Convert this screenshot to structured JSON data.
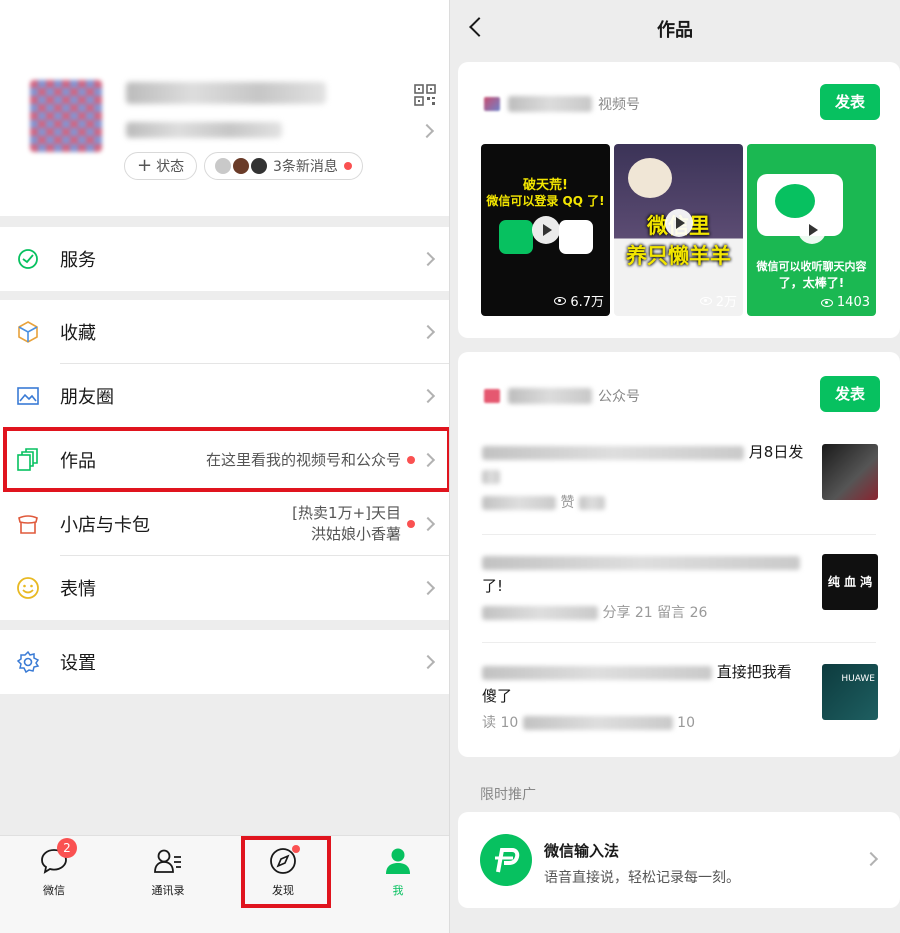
{
  "left": {
    "profile": {
      "status_label": "状态",
      "messages_label": "3条新消息"
    },
    "menu": {
      "service": "服务",
      "favorites": "收藏",
      "moments": "朋友圈",
      "works": "作品",
      "works_hint": "在这里看我的视频号和公众号",
      "shop": "小店与卡包",
      "shop_hint_line1": "[热卖1万+]天目",
      "shop_hint_line2": "洪姑娘小香薯",
      "stickers": "表情",
      "settings": "设置"
    },
    "tabbar": {
      "chats": "微信",
      "chats_badge": "2",
      "contacts": "通讯录",
      "discover": "发现",
      "me": "我"
    },
    "accent_highlight_color": "#e0141e"
  },
  "right": {
    "title": "作品",
    "channels_card": {
      "type_label": "视频号",
      "publish_label": "发表",
      "videos": [
        {
          "caption_line1": "破天荒!",
          "caption_line2": "微信可以登录 QQ 了!",
          "views": "6.7万"
        },
        {
          "caption_line1": "微信里",
          "caption_line2": "养只懒羊羊",
          "views": "2万"
        },
        {
          "caption_line1": "微信可以收听聊天内容",
          "caption_line2": "了，太棒了!",
          "views": "1403"
        }
      ]
    },
    "official_card": {
      "type_label": "公众号",
      "publish_label": "发表",
      "articles": [
        {
          "title_visible": "月8日发",
          "meta_visible": "赞"
        },
        {
          "title_visible": "了!",
          "meta_visible": "分享 21  留言 26"
        },
        {
          "title_visible": "直接把我看",
          "title_line2": "傻了",
          "meta_visible": "读 10",
          "meta_tail": "10"
        }
      ],
      "thumb_texts": [
        "",
        "纯 血 鸿 蒙",
        "HUAWE"
      ]
    },
    "promo": {
      "section_label": "限时推广",
      "title": "微信输入法",
      "desc": "语音直接说，轻松记录每一刻。"
    },
    "brand_green": "#07c160"
  }
}
